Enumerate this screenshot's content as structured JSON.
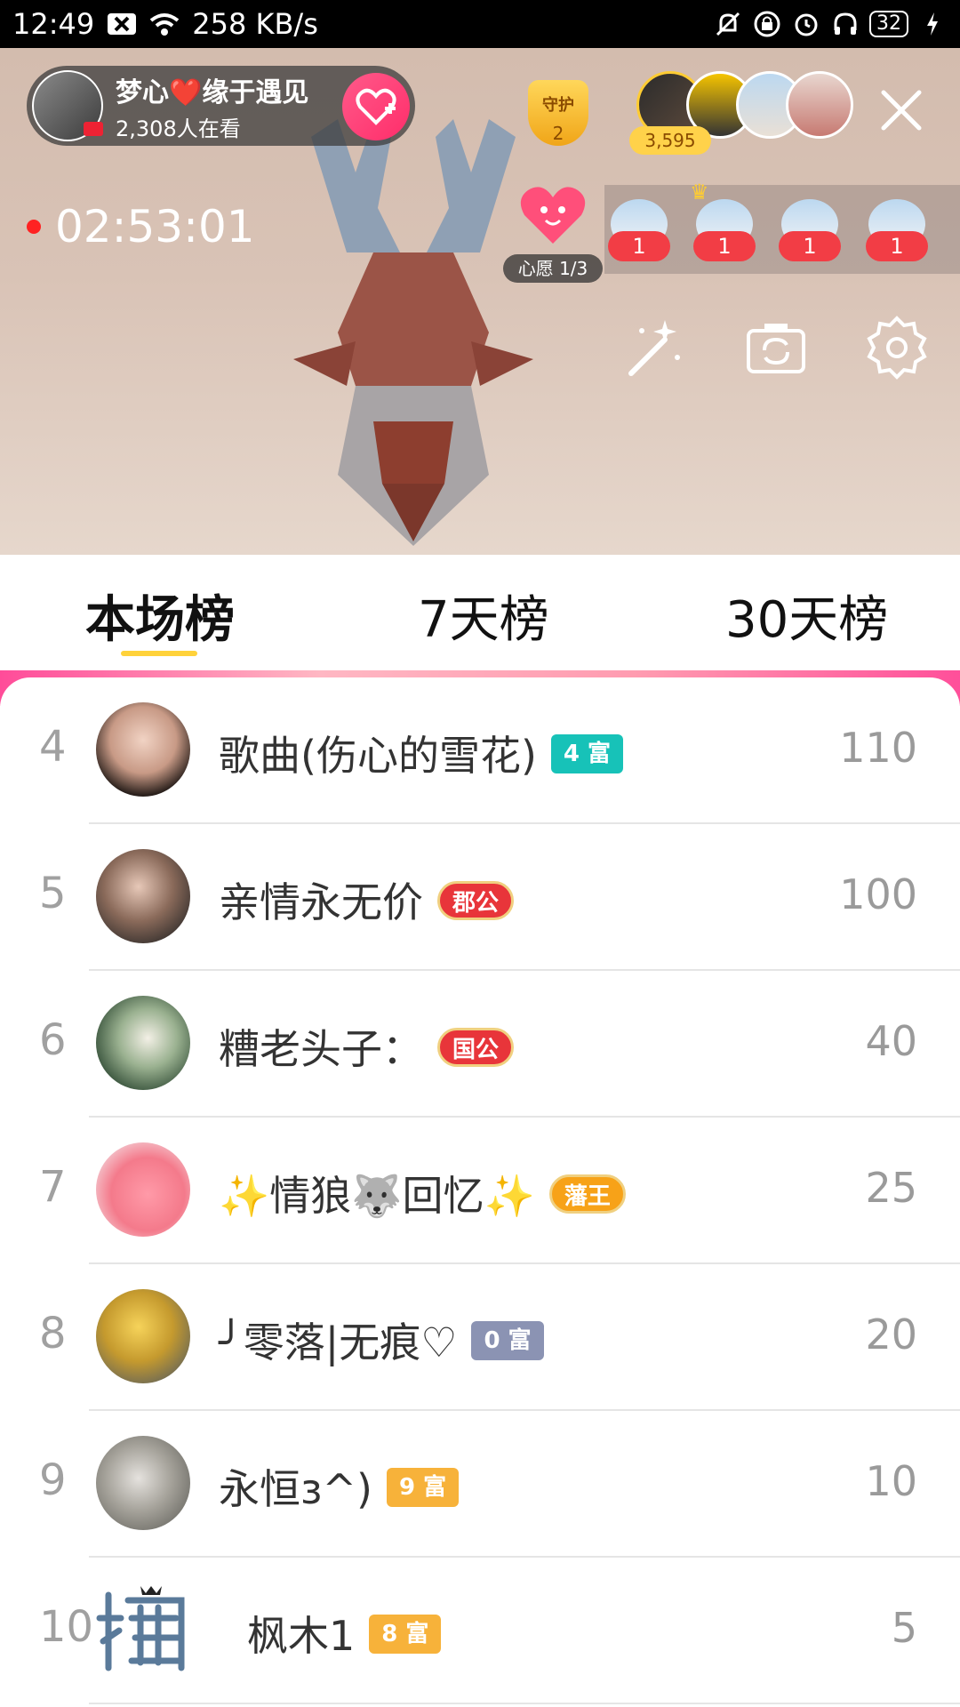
{
  "status_bar": {
    "time": "12:49",
    "net_speed": "258 KB/s",
    "battery": "32",
    "icons": [
      "mute-icon",
      "wifi-icon",
      "lock-icon",
      "alarm-icon",
      "headphones-icon",
      "battery-icon",
      "charging-icon"
    ]
  },
  "live": {
    "host_name": "梦心❤️缘于遇见",
    "viewer_count": "2,308人在看",
    "guard_title": "守护",
    "guard_count": "2",
    "score": "3,595",
    "timer": "02:53:01",
    "wish_label": "心愿 1/3",
    "gifters": [
      {
        "count": "1"
      },
      {
        "count": "1"
      },
      {
        "count": "1"
      },
      {
        "count": "1"
      }
    ]
  },
  "tabs": [
    {
      "label": "本场榜",
      "active": true
    },
    {
      "label": "7天榜",
      "active": false
    },
    {
      "label": "30天榜",
      "active": false
    }
  ],
  "ranking": [
    {
      "rank": "4",
      "name": "歌曲(伤心的雪花)",
      "badge": "4 富",
      "badge_color": "#17c2b8",
      "score": "110"
    },
    {
      "rank": "5",
      "name": "亲情永无价",
      "badge": "郡公",
      "badge_color": "#e8353a",
      "score": "100"
    },
    {
      "rank": "6",
      "name": "糟老头子：",
      "badge": "国公",
      "badge_color": "#e8353a",
      "score": "40"
    },
    {
      "rank": "7",
      "name": "✨情狼🐺回忆✨",
      "badge": "藩王",
      "badge_color": "#f7a218",
      "score": "25"
    },
    {
      "rank": "8",
      "name": "╯零落|无痕♡",
      "badge": "0 富",
      "badge_color": "#8b93b3",
      "score": "20"
    },
    {
      "rank": "9",
      "name": "永恒з^)",
      "badge": "9 富",
      "badge_color": "#f7b23a",
      "score": "10"
    },
    {
      "rank": "10",
      "name": "枫木1",
      "badge": "8 富",
      "badge_color": "#f7b23a",
      "score": "5"
    }
  ]
}
